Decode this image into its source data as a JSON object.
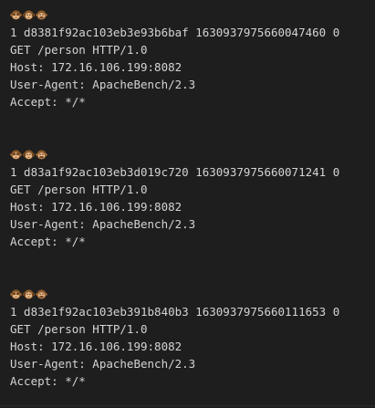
{
  "colors": {
    "background": "#1e1e1e",
    "text": "#d4d4d4",
    "monkey_fur": "#8b5a2b",
    "monkey_face": "#e8b98a"
  },
  "entries": [
    {
      "icons": [
        "see-no-evil-monkey-icon",
        "hear-no-evil-monkey-icon",
        "speak-no-evil-monkey-icon"
      ],
      "id_line": "1 d8381f92ac103eb3e93b6baf 1630937975660047460 0",
      "request_line": "GET /person HTTP/1.0",
      "host": "Host: 172.16.106.199:8082",
      "user_agent": "User-Agent: ApacheBench/2.3",
      "accept": "Accept: */*"
    },
    {
      "icons": [
        "see-no-evil-monkey-icon",
        "hear-no-evil-monkey-icon",
        "speak-no-evil-monkey-icon"
      ],
      "id_line": "1 d83a1f92ac103eb3d019c720 1630937975660071241 0",
      "request_line": "GET /person HTTP/1.0",
      "host": "Host: 172.16.106.199:8082",
      "user_agent": "User-Agent: ApacheBench/2.3",
      "accept": "Accept: */*"
    },
    {
      "icons": [
        "see-no-evil-monkey-icon",
        "hear-no-evil-monkey-icon",
        "speak-no-evil-monkey-icon"
      ],
      "id_line": "1 d83e1f92ac103eb391b840b3 1630937975660111653 0",
      "request_line": "GET /person HTTP/1.0",
      "host": "Host: 172.16.106.199:8082",
      "user_agent": "User-Agent: ApacheBench/2.3",
      "accept": "Accept: */*"
    }
  ]
}
